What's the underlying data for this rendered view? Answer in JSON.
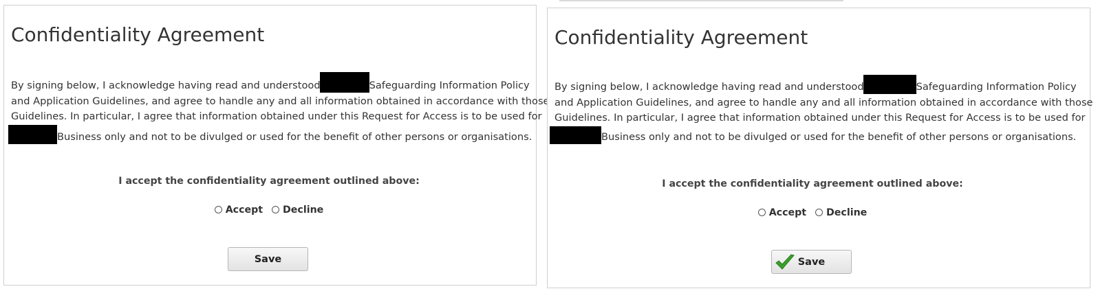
{
  "left_panel": {
    "title": "Confidentiality Agreement",
    "paragraph": {
      "line1_before": "By signing below, I acknowledge having read and understood",
      "line1_after": "Safeguarding Information Policy",
      "line2": "and Application Guidelines, and agree to handle any and all information obtained in accordance with those",
      "line3": "Guidelines. In particular, I agree that information obtained under this Request for Access is to be used for",
      "line4_after": "Business only and not to be divulged or used for the benefit of other persons or organisations."
    },
    "accept_prompt": "I accept the confidentiality agreement outlined above:",
    "options": [
      "Accept",
      "Decline"
    ],
    "save_label": "Save"
  },
  "right_panel": {
    "title": "Confidentiality Agreement",
    "paragraph": {
      "line1_before": "By signing below, I acknowledge having read and understood",
      "line1_after": "Safeguarding Information Policy",
      "line2": "and Application Guidelines, and agree to handle any and all information obtained in accordance with those",
      "line3": "Guidelines. In particular, I agree that information obtained under this Request for Access is to be used for",
      "line4_after": "Business only and not to be divulged or used for the benefit of other persons or organisations."
    },
    "accept_prompt": "I accept the confidentiality agreement outlined above:",
    "options": [
      "Accept",
      "Decline"
    ],
    "save_label": "Save",
    "save_icon": "green-checkmark-icon"
  },
  "colors": {
    "checkmark": "#3aa02a",
    "redaction": "#000000"
  }
}
